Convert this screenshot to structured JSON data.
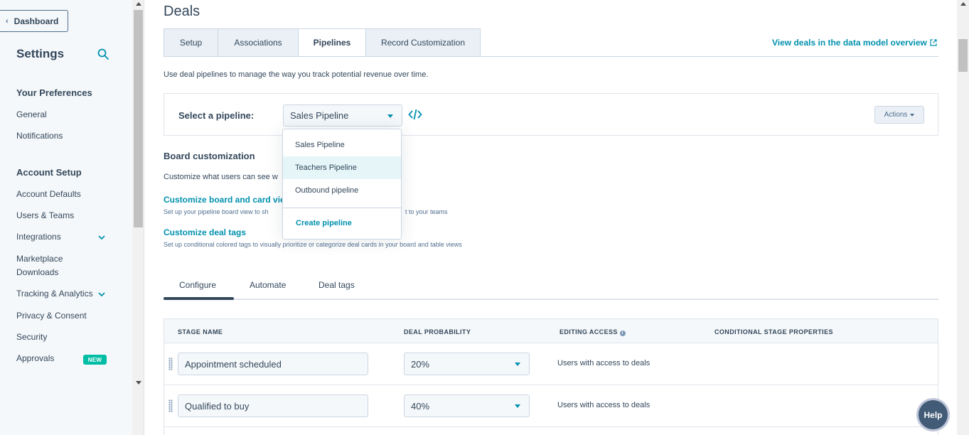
{
  "sidebar": {
    "dashboard_label": "Dashboard",
    "title": "Settings",
    "sections": [
      {
        "title": "Your Preferences",
        "items": [
          "General",
          "Notifications"
        ]
      },
      {
        "title": "Account Setup",
        "items": [
          "Account Defaults",
          "Users & Teams",
          "Integrations",
          "Marketplace\nDownloads",
          "Tracking & Analytics",
          "Privacy & Consent",
          "Security",
          "Approvals"
        ]
      }
    ],
    "approvals_badge": "NEW"
  },
  "page": {
    "title": "Deals",
    "tabs": [
      "Setup",
      "Associations",
      "Pipelines",
      "Record Customization"
    ],
    "active_tab": "Pipelines",
    "model_link": "View deals in the data model overview",
    "description": "Use deal pipelines to manage the way you track potential revenue over time."
  },
  "pipeline": {
    "select_label": "Select a pipeline:",
    "selected": "Sales Pipeline",
    "actions_label": "Actions",
    "options": [
      "Sales Pipeline",
      "Teachers Pipeline",
      "Outbound pipeline"
    ],
    "create_label": "Create pipeline"
  },
  "board": {
    "title": "Board customization",
    "description": "Customize what users can see w",
    "card_link": "Customize board and card vie",
    "card_desc": "Set up your pipeline board view to sh",
    "card_desc_tail": "t to your teams",
    "tags_link": "Customize deal tags",
    "tags_desc": "Set up conditional colored tags to visually prioritize or categorize deal cards in your board and table views"
  },
  "subtabs": [
    "Configure",
    "Automate",
    "Deal tags"
  ],
  "table": {
    "headers": [
      "STAGE NAME",
      "DEAL PROBABILITY",
      "EDITING ACCESS",
      "CONDITIONAL STAGE PROPERTIES"
    ],
    "rows": [
      {
        "stage": "Appointment scheduled",
        "probability": "20%",
        "access": "Users with access to deals"
      },
      {
        "stage": "Qualified to buy",
        "probability": "40%",
        "access": "Users with access to deals"
      }
    ]
  },
  "help_label": "Help",
  "colors": {
    "accent": "#0091ae",
    "text": "#33475b",
    "badge": "#00bda5"
  }
}
